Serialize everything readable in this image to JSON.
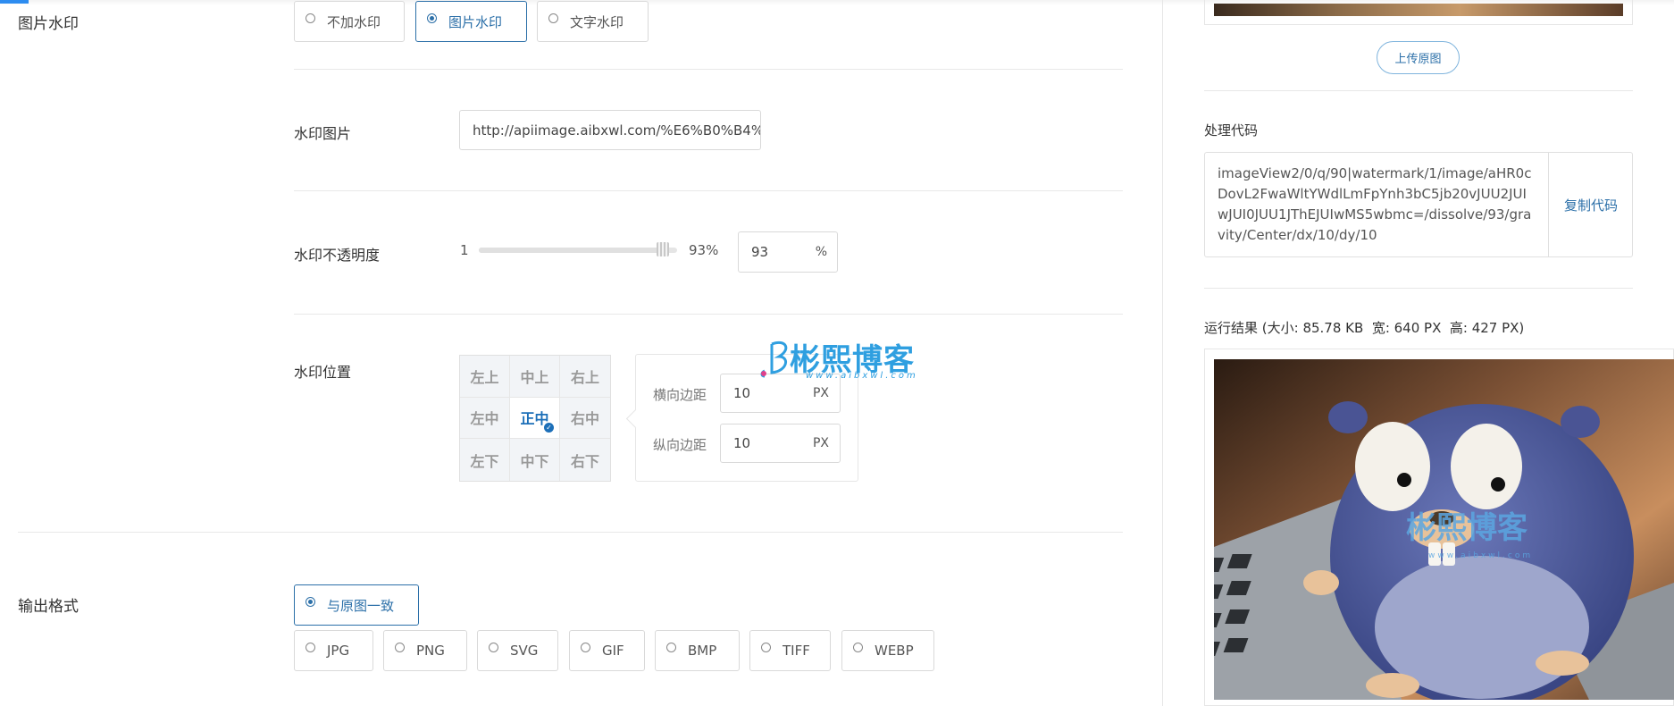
{
  "watermark_section": {
    "label": "图片水印",
    "options": [
      "不加水印",
      "图片水印",
      "文字水印"
    ],
    "selected": "图片水印"
  },
  "watermark_image": {
    "label": "水印图片",
    "value": "http://apiimage.aibxwl.com/%E6%B0%B4%"
  },
  "opacity": {
    "label": "水印不透明度",
    "min_label": "1",
    "value_label": "93%",
    "value": 93,
    "input_value": "93",
    "unit": "%"
  },
  "position": {
    "label": "水印位置",
    "cells": [
      "左上",
      "中上",
      "右上",
      "左中",
      "正中",
      "右中",
      "左下",
      "中下",
      "右下"
    ],
    "selected": "正中",
    "h_margin_label": "横向边距",
    "h_margin_value": "10",
    "v_margin_label": "纵向边距",
    "v_margin_value": "10",
    "unit": "PX"
  },
  "watermark_logo": {
    "text": "彬熙博客",
    "sub": "www.aibxwl.com"
  },
  "output_format": {
    "label": "输出格式",
    "primary_option": "与原图一致",
    "options": [
      "JPG",
      "PNG",
      "SVG",
      "GIF",
      "BMP",
      "TIFF",
      "WEBP"
    ],
    "selected": "与原图一致"
  },
  "right_panel": {
    "upload_button": "上传原图",
    "code_label": "处理代码",
    "code": "imageView2/0/q/90|watermark/1/image/aHR0cDovL2FwaWltYWdlLmFpYnh3bC5jb20vJUU2JUIwJUI0JUU1JThEJUIwMS5wbmc=/dissolve/93/gravity/Center/dx/10/dy/10",
    "copy_button": "复制代码",
    "result_label": "运行结果 (大小: 85.78 KB  宽: 640 PX  高: 427 PX)"
  },
  "colors": {
    "accent": "#2b6fa8",
    "border": "#d9d9d9"
  }
}
